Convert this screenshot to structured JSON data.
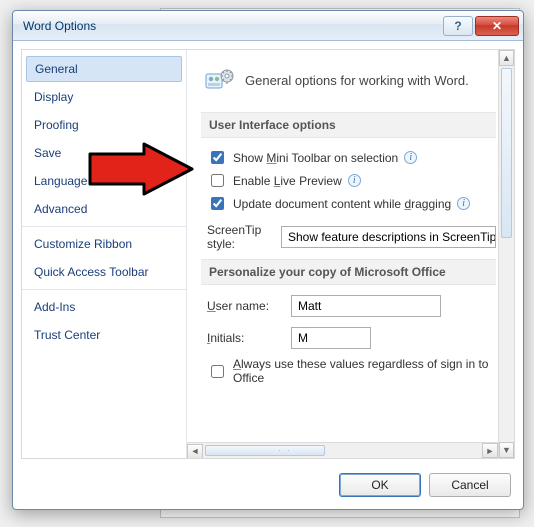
{
  "dialog": {
    "title": "Word Options"
  },
  "nav": {
    "items": [
      "General",
      "Display",
      "Proofing",
      "Save",
      "Language",
      "Advanced",
      "Customize Ribbon",
      "Quick Access Toolbar",
      "Add-Ins",
      "Trust Center"
    ],
    "selected_index": 0
  },
  "header": {
    "text": "General options for working with Word."
  },
  "section_ui": {
    "title": "User Interface options"
  },
  "opts": {
    "show_mini_toolbar": {
      "label_pre": "Show ",
      "label_u": "M",
      "label_post": "ini Toolbar on selection",
      "checked": true
    },
    "enable_live_preview": {
      "label_pre": "Enable ",
      "label_u": "L",
      "label_post": "ive Preview",
      "checked": false
    },
    "update_dragging": {
      "label_pre": "Update document content while ",
      "label_u": "d",
      "label_post": "ragging",
      "checked": true
    }
  },
  "screentip": {
    "label": "ScreenTip style:",
    "value": "Show feature descriptions in ScreenTips"
  },
  "section_personal": {
    "title": "Personalize your copy of Microsoft Office"
  },
  "personal": {
    "username_label_u": "U",
    "username_label_post": "ser name:",
    "username_value": "Matt",
    "initials_label_u": "I",
    "initials_label_post": "nitials:",
    "initials_value": "M",
    "always_label_u": "A",
    "always_label_post": "lways use these values regardless of sign in to Office",
    "always_checked": false
  },
  "buttons": {
    "ok": "OK",
    "cancel": "Cancel"
  },
  "titlebar": {
    "help_glyph": "?",
    "close_glyph": "✕"
  }
}
